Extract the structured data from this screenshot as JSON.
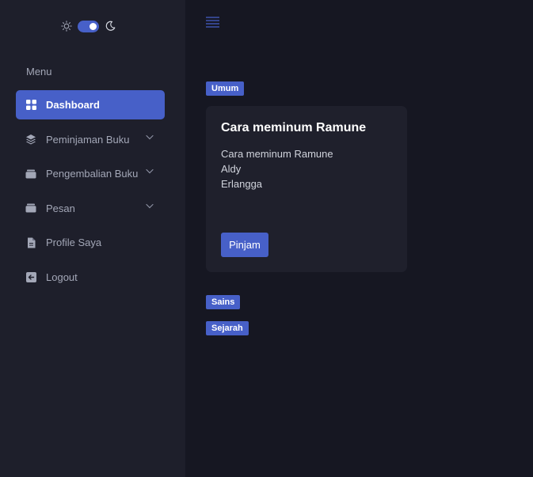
{
  "theme": {
    "mode": "dark",
    "accent": "#4760c8"
  },
  "sidebar": {
    "menu_heading": "Menu",
    "items": [
      {
        "label": "Dashboard",
        "icon": "grid-icon",
        "active": true
      },
      {
        "label": "Peminjaman Buku",
        "icon": "layers-icon",
        "expandable": true
      },
      {
        "label": "Pengembalian Buku",
        "icon": "folder-icon",
        "expandable": true
      },
      {
        "label": "Pesan",
        "icon": "folder-icon",
        "expandable": true
      },
      {
        "label": "Profile Saya",
        "icon": "document-icon"
      },
      {
        "label": "Logout",
        "icon": "logout-icon"
      }
    ]
  },
  "categories": [
    {
      "name": "Umum",
      "books": [
        {
          "title": "Cara meminum Ramune",
          "lines": [
            "Cara meminum Ramune",
            "Aldy",
            "Erlangga"
          ],
          "button": "Pinjam"
        }
      ]
    },
    {
      "name": "Sains",
      "books": []
    },
    {
      "name": "Sejarah",
      "books": []
    }
  ]
}
